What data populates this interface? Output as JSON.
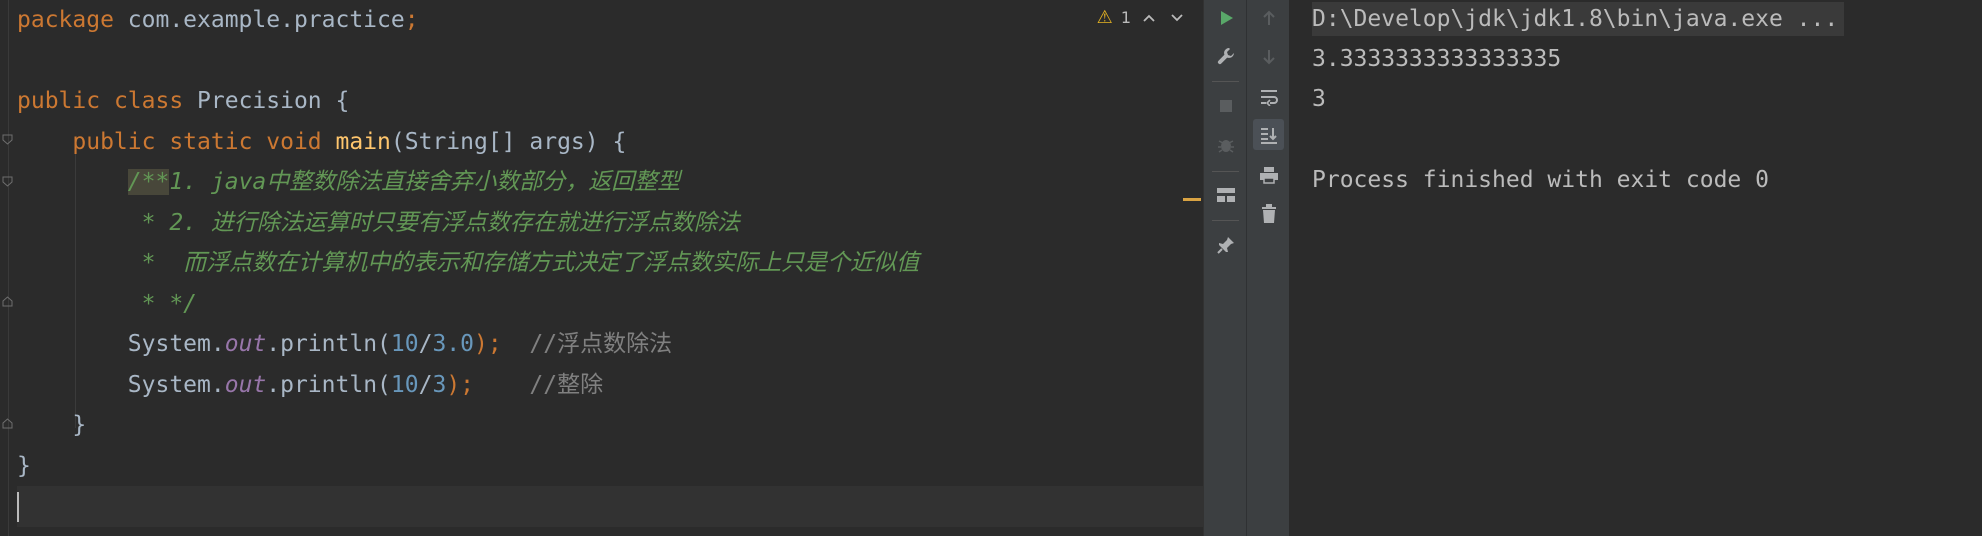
{
  "editor": {
    "lines": [
      {
        "tokens": [
          {
            "t": "package ",
            "c": "kw"
          },
          {
            "t": "com.example.practice",
            "c": "pl"
          },
          {
            "t": ";",
            "c": "kw"
          }
        ]
      },
      {
        "tokens": []
      },
      {
        "tokens": [
          {
            "t": "public ",
            "c": "kw"
          },
          {
            "t": "class ",
            "c": "kw"
          },
          {
            "t": "Precision {",
            "c": "pl"
          }
        ]
      },
      {
        "tokens": [
          {
            "t": "    ",
            "c": "pl"
          },
          {
            "t": "public ",
            "c": "kw"
          },
          {
            "t": "static ",
            "c": "kw"
          },
          {
            "t": "void ",
            "c": "kw"
          },
          {
            "t": "main",
            "c": "fn"
          },
          {
            "t": "(String[] args) {",
            "c": "pl"
          }
        ]
      },
      {
        "tokens": [
          {
            "t": "        ",
            "c": "pl"
          },
          {
            "t": "/**",
            "c": "docstart"
          },
          {
            "t": "1. java",
            "c": "doc"
          },
          {
            "t": "中整数除法直接舍弃小数部分，返回整型",
            "c": "doc cjk"
          }
        ]
      },
      {
        "tokens": [
          {
            "t": "         ",
            "c": "pl"
          },
          {
            "t": "* 2. ",
            "c": "doc"
          },
          {
            "t": "进行除法运算时只要有浮点数存在就进行浮点数除法",
            "c": "doc cjk"
          }
        ]
      },
      {
        "tokens": [
          {
            "t": "         ",
            "c": "pl"
          },
          {
            "t": "*  ",
            "c": "doc"
          },
          {
            "t": "而浮点数在计算机中的表示和存储方式决定了浮点数实际上只是个近似值",
            "c": "doc cjk"
          }
        ]
      },
      {
        "tokens": [
          {
            "t": "         ",
            "c": "pl"
          },
          {
            "t": "* */",
            "c": "doc"
          }
        ]
      },
      {
        "tokens": [
          {
            "t": "        ",
            "c": "pl"
          },
          {
            "t": "System.",
            "c": "pl"
          },
          {
            "t": "out",
            "c": "st"
          },
          {
            "t": ".println(",
            "c": "pl"
          },
          {
            "t": "10",
            "c": "num"
          },
          {
            "t": "/",
            "c": "pl"
          },
          {
            "t": "3.0",
            "c": "num"
          },
          {
            "t": ");",
            "c": "kw"
          },
          {
            "t": "  //",
            "c": "cm"
          },
          {
            "t": "浮点数除法",
            "c": "cm cjk"
          }
        ]
      },
      {
        "tokens": [
          {
            "t": "        ",
            "c": "pl"
          },
          {
            "t": "System.",
            "c": "pl"
          },
          {
            "t": "out",
            "c": "st"
          },
          {
            "t": ".println(",
            "c": "pl"
          },
          {
            "t": "10",
            "c": "num"
          },
          {
            "t": "/",
            "c": "pl"
          },
          {
            "t": "3",
            "c": "num"
          },
          {
            "t": ");",
            "c": "kw"
          },
          {
            "t": "    //",
            "c": "cm"
          },
          {
            "t": "整除",
            "c": "cm cjk"
          }
        ]
      },
      {
        "tokens": [
          {
            "t": "    }",
            "c": "pl"
          }
        ]
      },
      {
        "tokens": [
          {
            "t": "}",
            "c": "pl"
          }
        ]
      },
      {
        "tokens": []
      }
    ],
    "inspection": {
      "warning_count": "1",
      "icon": "warning-icon"
    }
  },
  "toolbar": {
    "primary": [
      "rerun-icon",
      "wrench-icon",
      "stop-icon",
      "debug-bug-icon",
      "layout-icon",
      "pin-icon"
    ],
    "secondary": [
      "arrow-up-icon",
      "arrow-down-icon",
      "soft-wrap-icon",
      "scroll-to-end-icon",
      "print-icon",
      "trash-icon"
    ]
  },
  "console": {
    "command": "D:\\Develop\\jdk\\jdk1.8\\bin\\java.exe ...",
    "output_1": "3.3333333333333335",
    "output_2": "3",
    "finished": "Process finished with exit code 0"
  },
  "colors": {
    "background": "#2b2b2b",
    "keyword": "#cc7832",
    "method": "#ffc66d",
    "static_field": "#9876aa",
    "number": "#6897bb",
    "doc_comment": "#629755",
    "line_comment": "#808080",
    "toolbar": "#3c3f41"
  }
}
